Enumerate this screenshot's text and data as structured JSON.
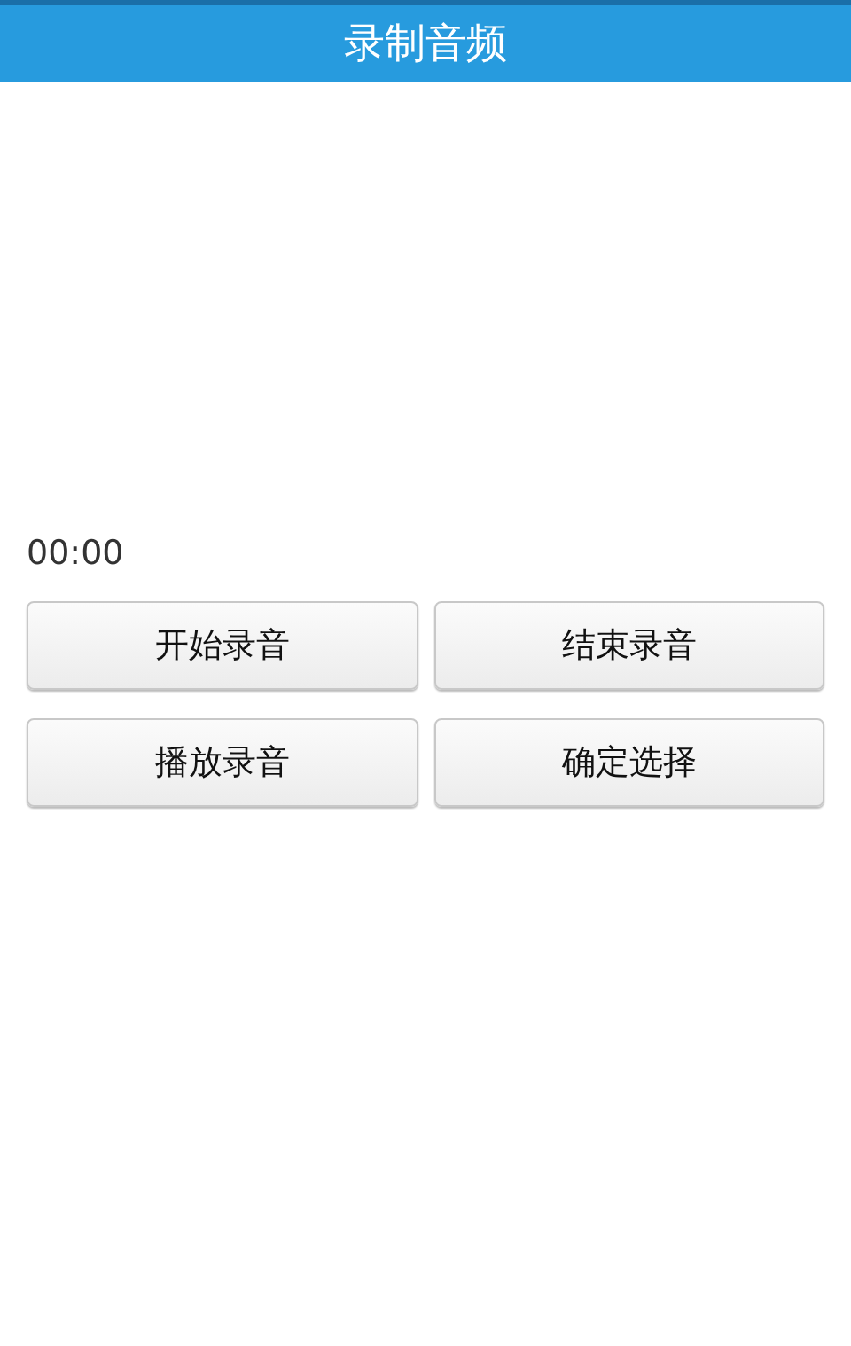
{
  "title_bar": {
    "title": "录制音频"
  },
  "timer": "00:00",
  "buttons": [
    {
      "label": "开始录音"
    },
    {
      "label": "结束录音"
    },
    {
      "label": "播放录音"
    },
    {
      "label": "确定选择"
    }
  ]
}
